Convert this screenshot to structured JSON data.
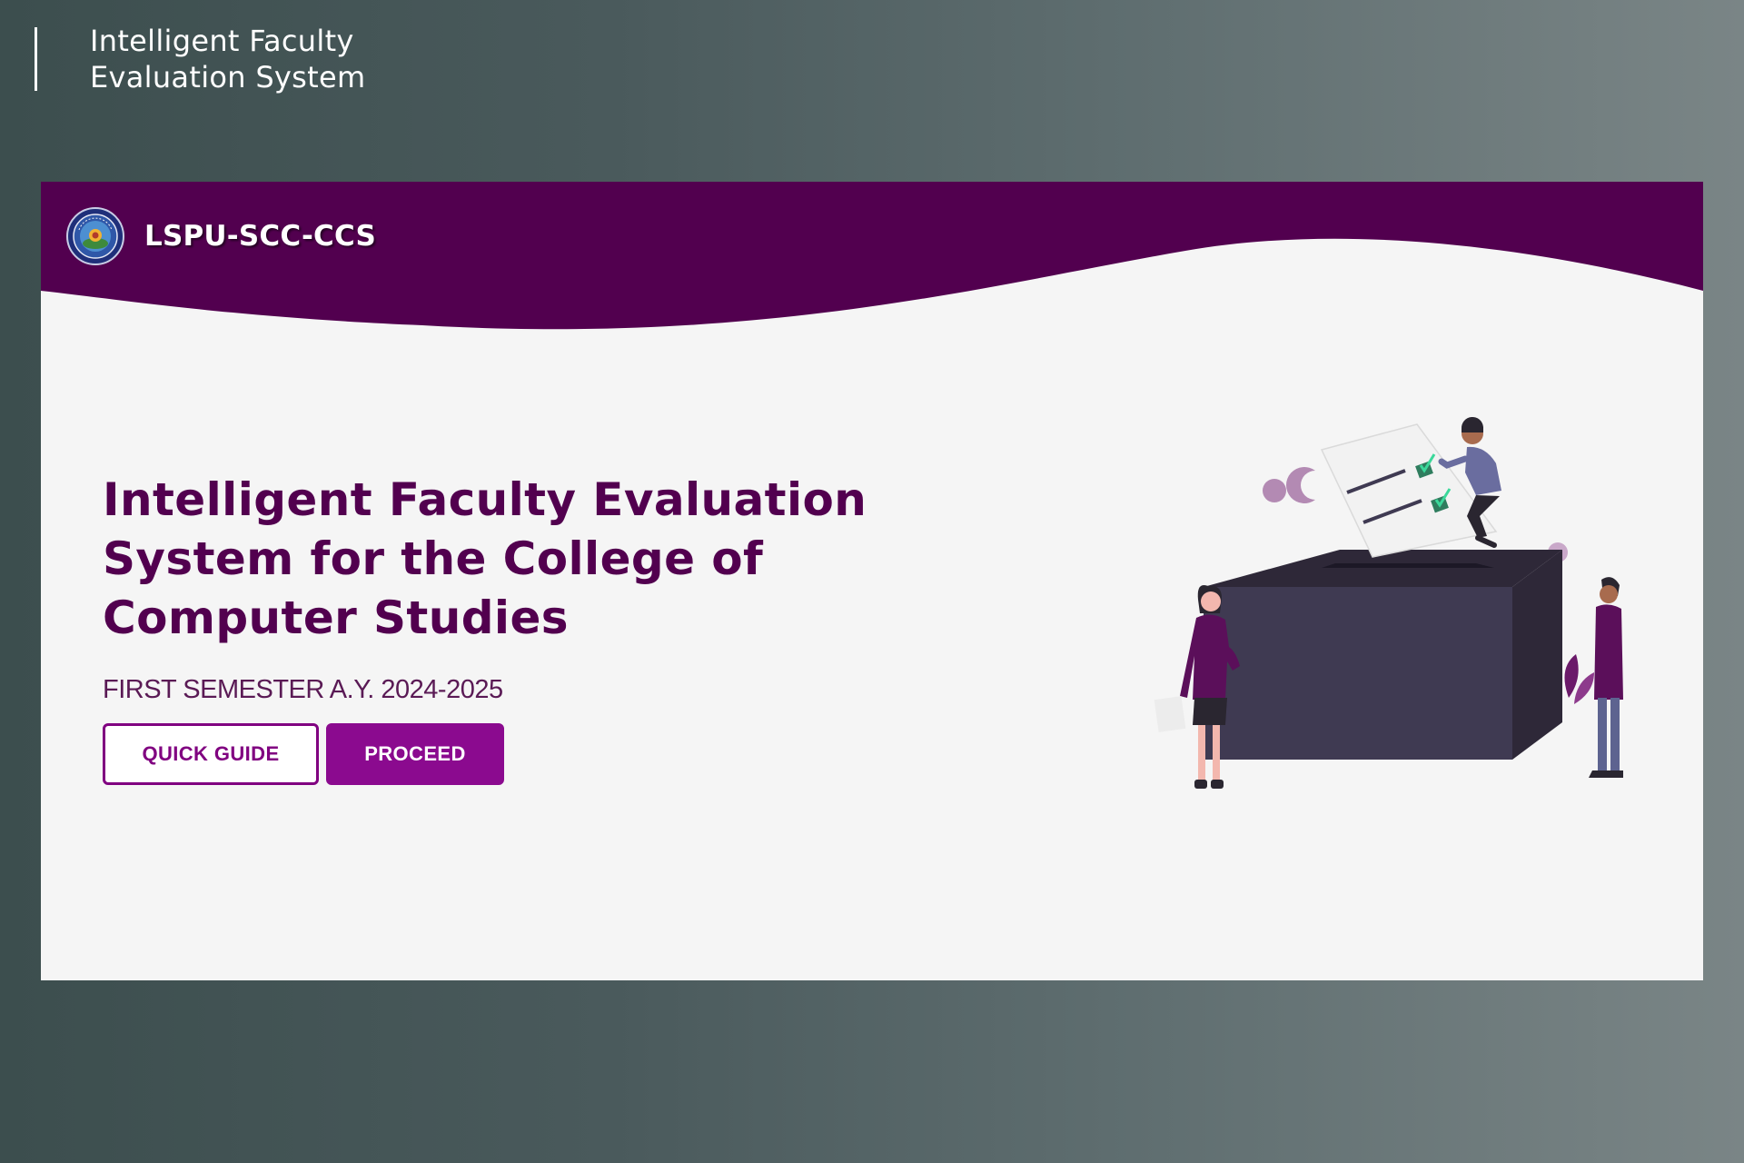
{
  "caption": {
    "line1": "Intelligent Faculty",
    "line2": "Evaluation System"
  },
  "header": {
    "brand_name": "LSPU-SCC-CCS"
  },
  "hero": {
    "title_lines": [
      "Intelligent Faculty Evaluation",
      "System for the College of",
      "Computer Studies"
    ],
    "semester": "FIRST SEMESTER A.Y. 2024-2025",
    "quick_guide_label": "QUICK GUIDE",
    "proceed_label": "PROCEED"
  },
  "colors": {
    "header_purple": "#52004f",
    "accent_purple": "#8b0a8f",
    "page_background": "#f5f5f5"
  },
  "icons": {
    "logo": "university-seal-logo",
    "illustration": "voting-ballot-box-illustration"
  }
}
